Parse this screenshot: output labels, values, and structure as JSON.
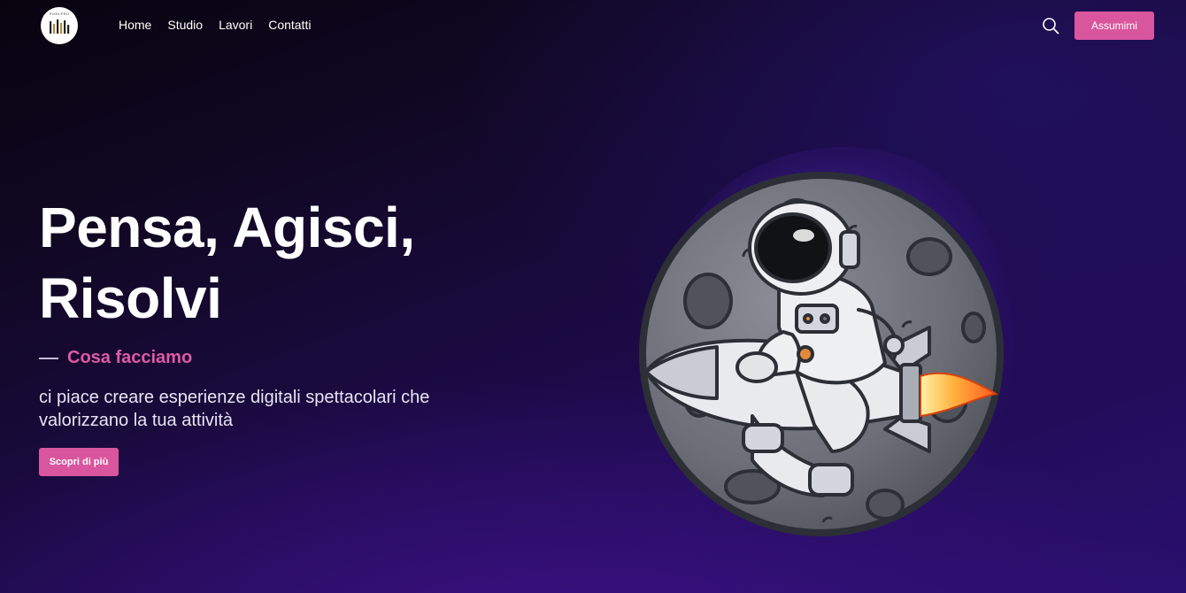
{
  "nav": {
    "logo_text": "PIXELPRO",
    "links": [
      {
        "label": "Home"
      },
      {
        "label": "Studio"
      },
      {
        "label": "Lavori"
      },
      {
        "label": "Contatti"
      }
    ],
    "search_icon": "search-icon",
    "cta_label": "Assumimi"
  },
  "hero": {
    "title_line1": "Pensa, Agisci,",
    "title_line2": "Risolvi",
    "section_label": "Cosa facciamo",
    "description": "ci piace creare esperienze digitali spettacolari che valorizzano la tua attività",
    "button_label": "Scopri di più"
  },
  "colors": {
    "accent": "#d9559e",
    "accent_text": "#dd5aa3",
    "background_dark": "#07040f",
    "background_purple": "#2a0f6e"
  },
  "illustration": {
    "subject": "astronaut-riding-rocket-on-moon"
  }
}
